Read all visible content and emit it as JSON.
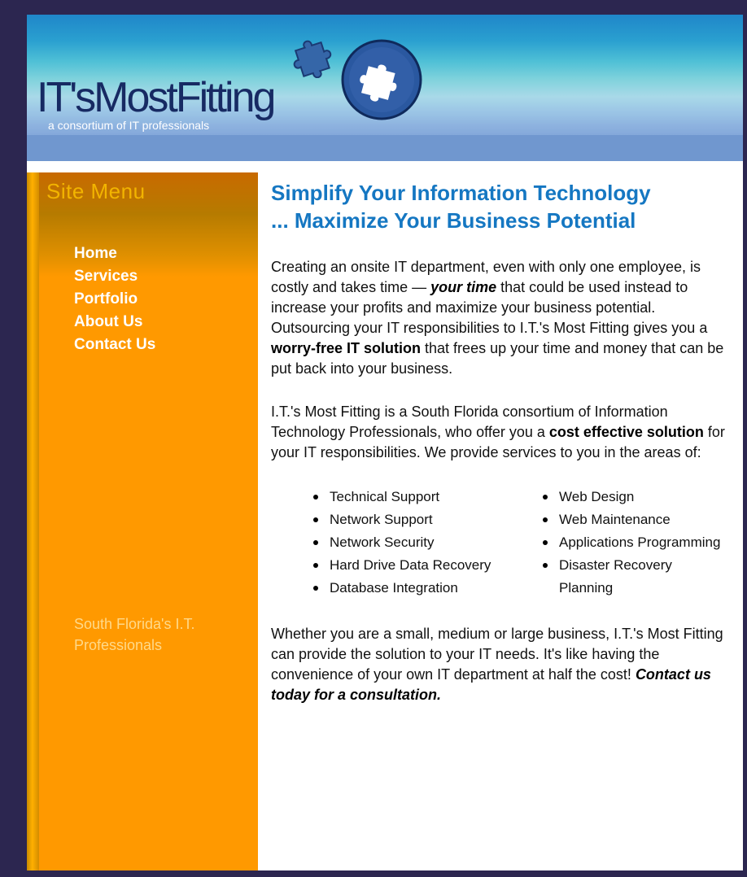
{
  "header": {
    "logo_text": "IT'sMostFitting",
    "tagline": "a consortium of IT professionals"
  },
  "sidebar": {
    "title": "Site Menu",
    "nav": [
      {
        "label": "Home"
      },
      {
        "label": "Services"
      },
      {
        "label": "Portfolio"
      },
      {
        "label": "About Us"
      },
      {
        "label": "Contact Us"
      }
    ],
    "note": "South Florida's I.T. Professionals"
  },
  "main": {
    "headline_line1": "Simplify Your Information Technology",
    "headline_line2": "... Maximize Your Business Potential",
    "para1": {
      "a": "Creating an onsite IT department, even with only one employee, is costly and takes time — ",
      "b": "your time",
      "c": " that could be used instead to increase your profits and maximize your business potential. Outsourcing your IT responsibilities to I.T.'s Most Fitting gives you a ",
      "d": "worry-free IT solution",
      "e": " that frees up your time and money that can be put back into your business."
    },
    "para2": {
      "a": "I.T.'s Most Fitting is a South Florida consortium of Information Technology Professionals, who offer you a ",
      "b": "cost effective solution",
      "c": " for your IT responsibilities. We provide services to you in the areas of:"
    },
    "services_left": [
      "Technical Support",
      "Network Support",
      "Network Security",
      "Hard Drive Data Recovery",
      "Database Integration"
    ],
    "services_right": [
      "Web Design",
      "Web Maintenance",
      "Applications Programming",
      "Disaster Recovery Planning"
    ],
    "para3": {
      "a": "Whether you are a small, medium or large business, I.T.'s Most Fitting can provide the solution to your IT needs. It's like having the convenience of your own IT department at half the cost! ",
      "b": "Contact us today for a consultation."
    }
  },
  "colors": {
    "page_border": "#2c2650",
    "sidebar": "#ff9900",
    "headline": "#1577c2",
    "logo_text": "#172a63"
  },
  "icons": {
    "logo_circle": "puzzle-circle-icon",
    "logo_piece": "puzzle-piece-icon"
  }
}
